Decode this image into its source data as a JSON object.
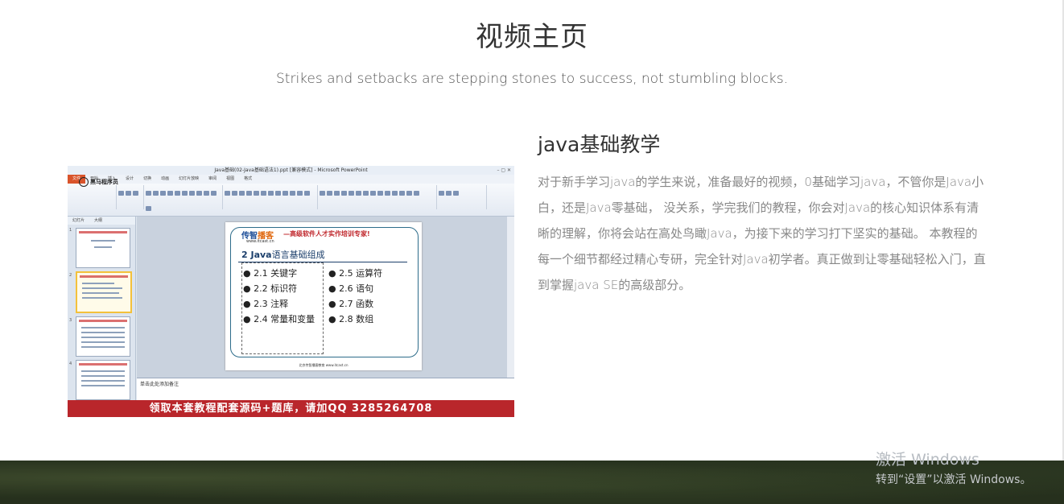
{
  "page": {
    "title": "视频主页",
    "subtitle": "Strikes and setbacks are stepping stones to success, not stumbling blocks."
  },
  "course": {
    "title": "java基础教学",
    "description": "对于新手学习java的学生来说，准备最好的视频，0基础学习java，不管你是Java小白，还是Java零基础， 没关系，学完我们的教程，你会对Java的核心知识体系有清晰的理解，你将会站在高处鸟瞰Java，为接下来的学习打下坚实的基础。 本教程的每一个细节都经过精心专研，完全针对Java初学者。真正做到让零基础轻松入门，直到掌握java SE的高级部分。"
  },
  "video": {
    "window_title": "Java基础(02-Java基础语法1).ppt [兼容模式] - Microsoft PowerPoint",
    "ribbon_tabs": [
      "文件",
      "开始",
      "插入",
      "设计",
      "切换",
      "动画",
      "幻灯片放映",
      "审阅",
      "视图",
      "格式"
    ],
    "logo_overlay": "黑马程序员",
    "sidebar_tabs": [
      "幻灯片",
      "大纲"
    ],
    "slide": {
      "brand_a": "传智",
      "brand_b": "播客",
      "url": "www.itcast.cn",
      "slogan": "—高级软件人才实作培训专家!",
      "heading_bold": "2 Java",
      "heading_rest": "语言基础组成",
      "left_items": [
        "● 2.1 关键字",
        "● 2.2 标识符",
        "● 2.3 注释",
        "● 2.4 常量和变量"
      ],
      "right_items": [
        "● 2.5 运算符",
        "● 2.6 语句",
        "● 2.7 函数",
        "● 2.8 数组"
      ],
      "footer": "北京传智播客教育 www.itcast.cn"
    },
    "notes_placeholder": "单击此处添加备注",
    "banner": "领取本套教程配套源码+题库，请加QQ 3285264708"
  },
  "watermark": {
    "line1": "激活 Windows",
    "line2": "转到“设置”以激活 Windows。"
  }
}
